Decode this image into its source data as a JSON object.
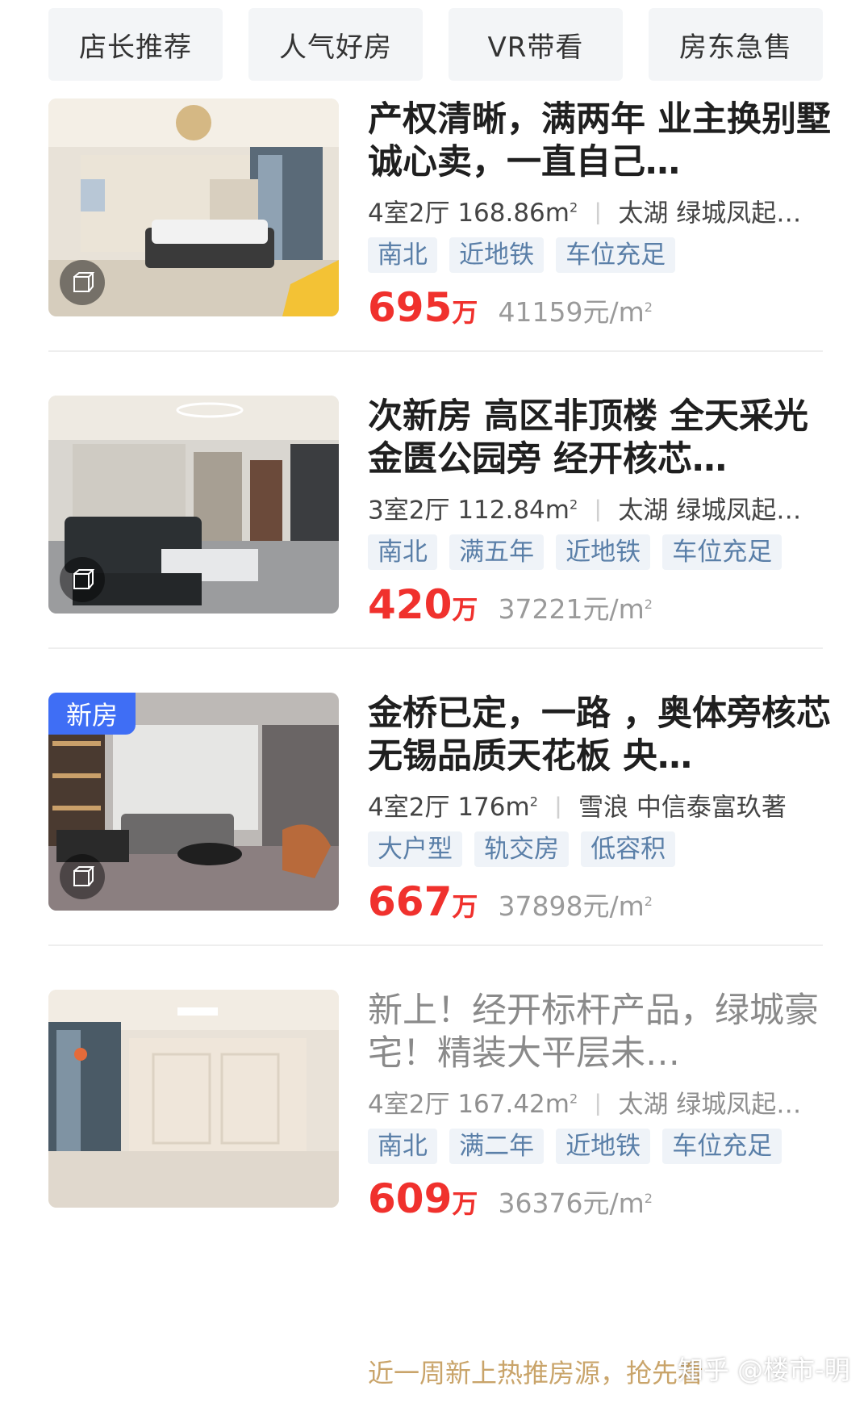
{
  "tabs": [
    "店长推荐",
    "人气好房",
    "VR带看",
    "房东急售"
  ],
  "listings": [
    {
      "title": "产权清晰，满两年 业主换别墅诚心卖，一直自己…",
      "layout": "4室2厅",
      "area": "168.86m",
      "area_sup": "2",
      "district": "太湖",
      "community": "绿城凤起…",
      "tags": [
        "南北",
        "近地铁",
        "车位充足"
      ],
      "price": "695",
      "price_unit": "万",
      "unit_price": "41159元/m",
      "unit_price_sup": "2",
      "badge": ""
    },
    {
      "title": "次新房 高区非顶楼 全天采光 金匮公园旁 经开核芯…",
      "layout": "3室2厅",
      "area": "112.84m",
      "area_sup": "2",
      "district": "太湖",
      "community": "绿城凤起…",
      "tags": [
        "南北",
        "满五年",
        "近地铁",
        "车位充足"
      ],
      "price": "420",
      "price_unit": "万",
      "unit_price": "37221元/m",
      "unit_price_sup": "2",
      "badge": ""
    },
    {
      "title": "金桥已定，一路 ，奥体旁核芯 无锡品质天花板 央…",
      "layout": "4室2厅",
      "area": "176m",
      "area_sup": "2",
      "district": "雪浪",
      "community": "中信泰富玖著",
      "tags": [
        "大户型",
        "轨交房",
        "低容积"
      ],
      "price": "667",
      "price_unit": "万",
      "unit_price": "37898元/m",
      "unit_price_sup": "2",
      "badge": "新房"
    },
    {
      "title": "新上！经开标杆产品，绿城豪宅！精装大平层未…",
      "layout": "4室2厅",
      "area": "167.42m",
      "area_sup": "2",
      "district": "太湖",
      "community": "绿城凤起…",
      "tags": [
        "南北",
        "满二年",
        "近地铁",
        "车位充足"
      ],
      "price": "609",
      "price_unit": "万",
      "unit_price": "36376元/m",
      "unit_price_sup": "2",
      "badge": ""
    }
  ],
  "promo_text": "近一周新上热推房源，抢先看",
  "watermark": "知乎 @楼市-明",
  "colors": {
    "price": "#f0312d",
    "tag_bg": "#eff3f8",
    "tag_text": "#5a7fa8",
    "badge": "#3f6ef5",
    "promo": "#c9a46a"
  }
}
